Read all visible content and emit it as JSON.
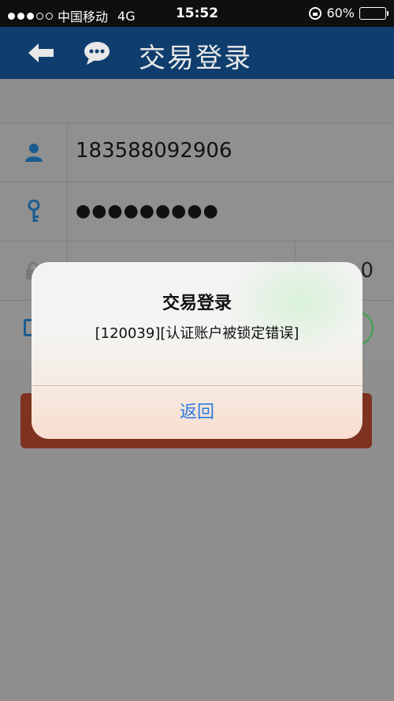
{
  "status_bar": {
    "carrier": "中国移动",
    "network": "4G",
    "time": "15:52",
    "battery": "60%",
    "battery_level": 0.6
  },
  "header": {
    "title": "交易登录",
    "back_icon": "back-arrow-icon",
    "chat_icon": "chat-bubble-icon"
  },
  "form": {
    "account": "183588092906",
    "password_mask": "●●●●●●●●●",
    "captcha_code": "0"
  },
  "alert": {
    "title": "交易登录",
    "message": "[120039][认证账户被锁定错误]",
    "button_label": "返回"
  },
  "colors": {
    "header_bg": "#0f3e6e",
    "accent_blue": "#2a7de0",
    "login_button": "#7e3220"
  }
}
